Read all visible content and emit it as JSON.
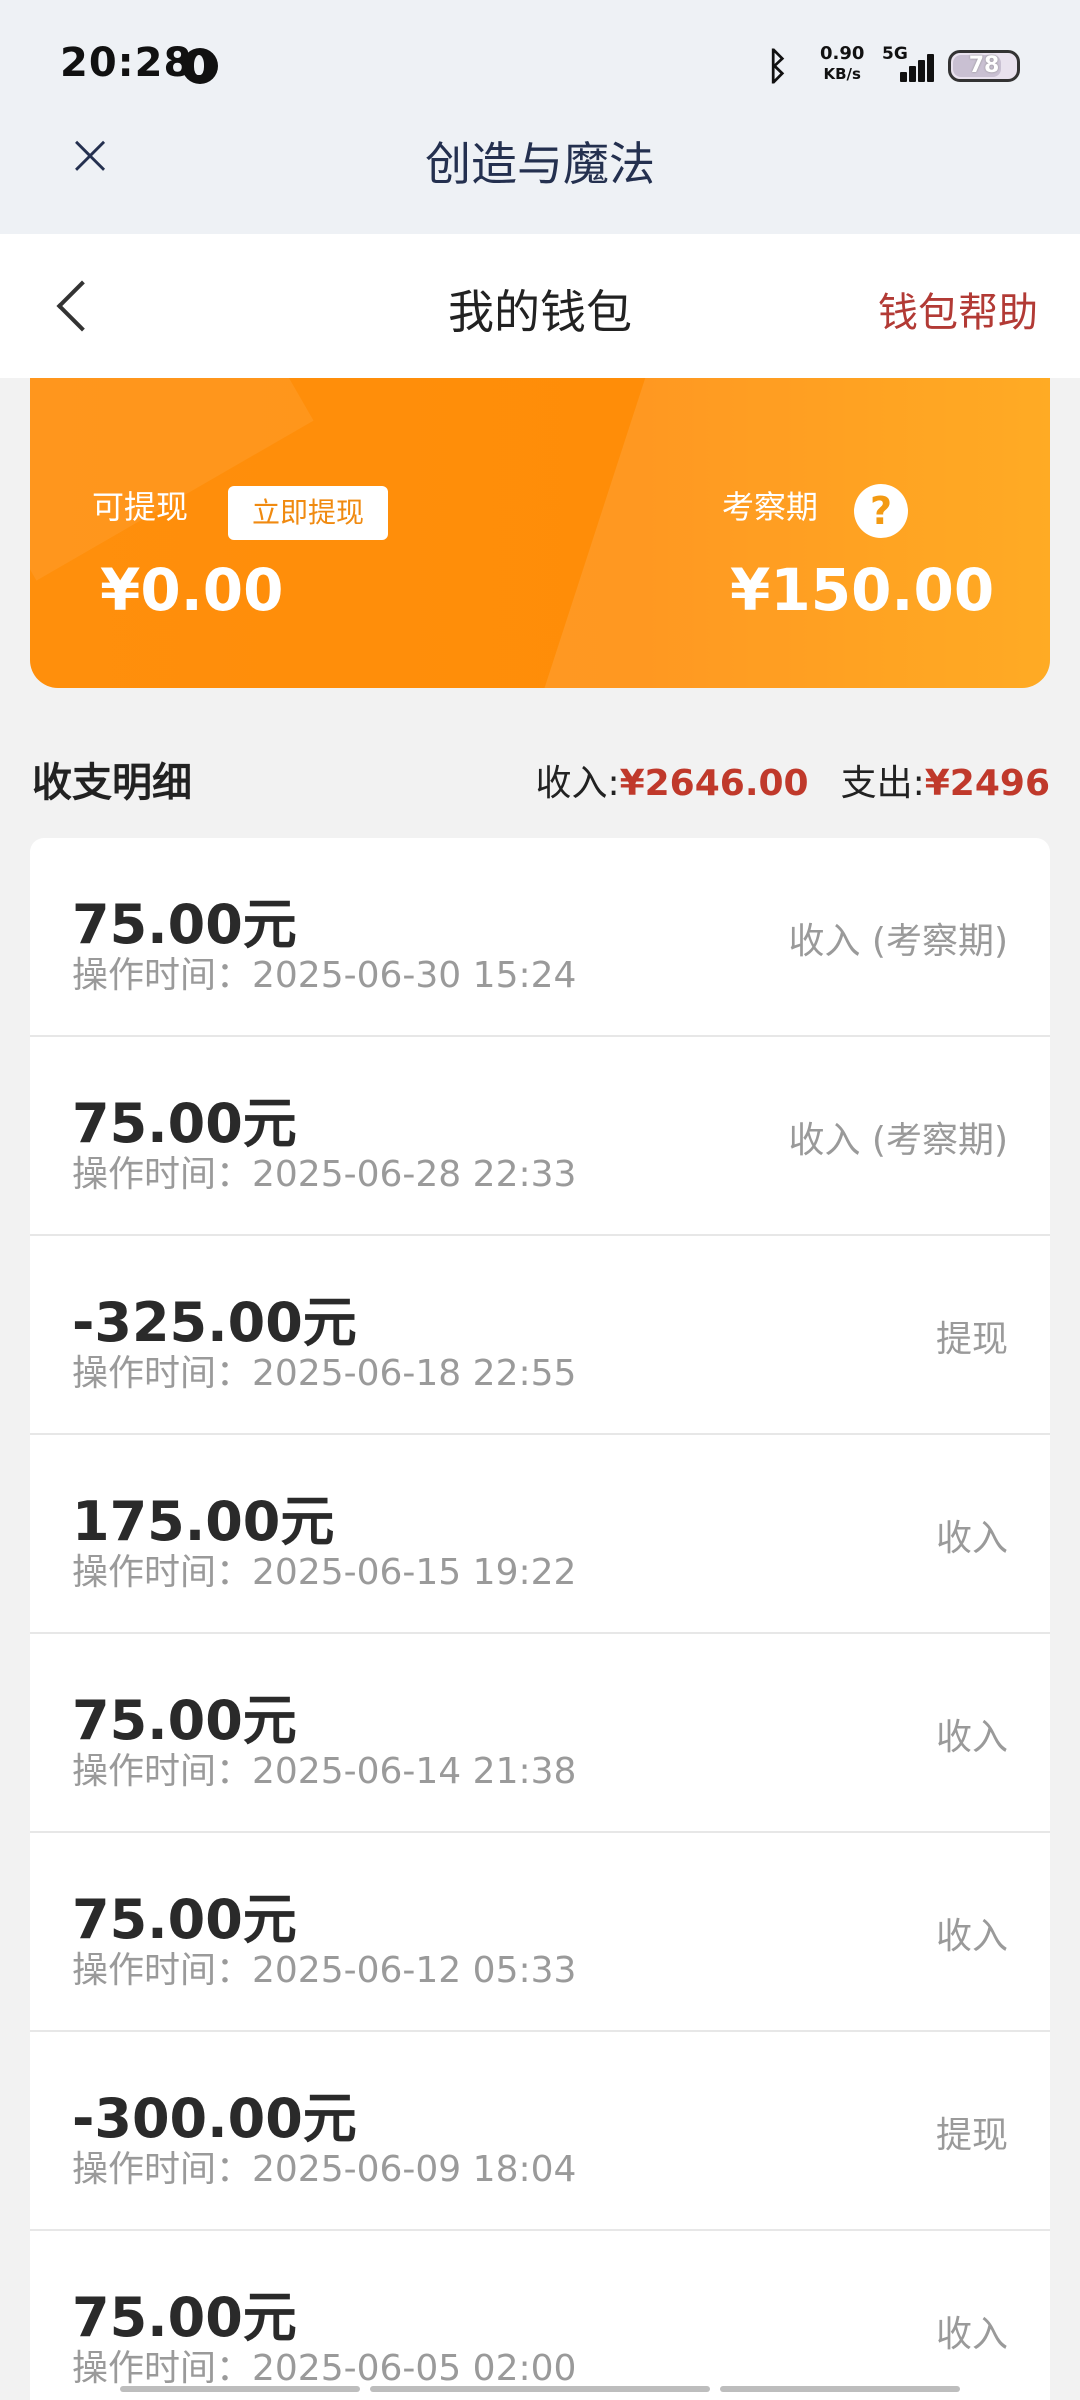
{
  "status_bar": {
    "time": "20:28",
    "net_speed_value": "0.90",
    "net_speed_unit": "KB/s",
    "network": "5G",
    "battery": "78",
    "icons": [
      "app-notification-icon",
      "bluetooth-icon",
      "signal-icon",
      "battery-icon"
    ]
  },
  "app_bar": {
    "close_icon": "×",
    "title": "创造与魔法"
  },
  "nav": {
    "back_icon": "chevron-left-icon",
    "title": "我的钱包",
    "help": "钱包帮助"
  },
  "card": {
    "withdrawable_label": "可提现",
    "withdraw_button": "立即提现",
    "withdrawable_amount": "¥0.00",
    "probation_label": "考察期",
    "probation_help": "?",
    "probation_amount": "¥150.00"
  },
  "summary": {
    "title": "收支明细",
    "income_label": "收入:",
    "income_amount": "¥2646.00",
    "expense_label": "支出:",
    "expense_amount": "¥2496"
  },
  "transactions": [
    {
      "amount": "75.00元",
      "time": "操作时间：2025-06-30 15:24",
      "type": "收入 (考察期)"
    },
    {
      "amount": "75.00元",
      "time": "操作时间：2025-06-28 22:33",
      "type": "收入 (考察期)"
    },
    {
      "amount": "-325.00元",
      "time": "操作时间：2025-06-18 22:55",
      "type": "提现"
    },
    {
      "amount": "175.00元",
      "time": "操作时间：2025-06-15 19:22",
      "type": "收入"
    },
    {
      "amount": "75.00元",
      "time": "操作时间：2025-06-14 21:38",
      "type": "收入"
    },
    {
      "amount": "75.00元",
      "time": "操作时间：2025-06-12 05:33",
      "type": "收入"
    },
    {
      "amount": "-300.00元",
      "time": "操作时间：2025-06-09 18:04",
      "type": "提现"
    },
    {
      "amount": "75.00元",
      "time": "操作时间：2025-06-05 02:00",
      "type": "收入"
    }
  ],
  "colors": {
    "accent_orange": "#ff8d08",
    "help_red": "#b23a35",
    "amount_red": "#c0392b"
  }
}
